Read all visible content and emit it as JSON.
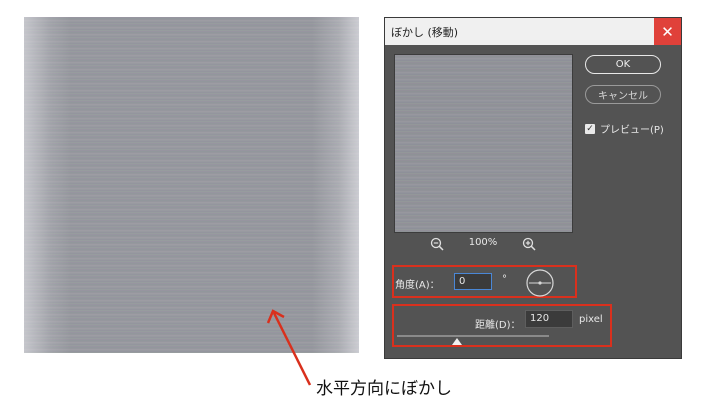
{
  "dialog": {
    "title": "ぼかし (移動)",
    "close_icon": "close-icon",
    "ok_label": "OK",
    "cancel_label": "キャンセル",
    "preview_label": "プレビュー(P)",
    "preview_checked": true,
    "zoom_level": "100%",
    "angle_label": "角度(A)：",
    "angle_value": "0",
    "degree_symbol": "°",
    "distance_label": "距離(D)：",
    "distance_value": "120",
    "distance_unit": "pixel"
  },
  "annotation": {
    "caption": "水平方向にぼかし",
    "highlight_color": "#d9301d"
  },
  "colors": {
    "dialog_bg": "#535353",
    "close_button": "#e0413a"
  }
}
